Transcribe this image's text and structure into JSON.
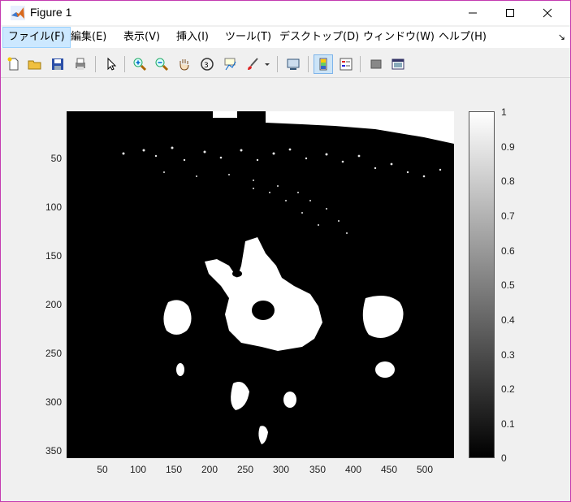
{
  "window": {
    "title": "Figure 1"
  },
  "menu": [
    {
      "label": "ファイル(F)"
    },
    {
      "label": "編集(E)"
    },
    {
      "label": "表示(V)"
    },
    {
      "label": "挿入(I)"
    },
    {
      "label": "ツール(T)"
    },
    {
      "label": "デスクトップ(D)"
    },
    {
      "label": "ウィンドウ(W)"
    },
    {
      "label": "ヘルプ(H)"
    }
  ],
  "toolbar_icons": [
    "new-figure-icon",
    "open-file-icon",
    "save-icon",
    "print-icon",
    "select-arrow-icon",
    "zoom-in-icon",
    "zoom-out-icon",
    "pan-hand-icon",
    "rotate-3d-icon",
    "data-cursor-icon",
    "brush-icon",
    "link-plot-icon",
    "colorbar-icon",
    "legend-icon",
    "hide-plot-tools-icon",
    "show-plot-tools-icon"
  ],
  "plot": {
    "y_ticks": [
      "50",
      "100",
      "150",
      "200",
      "250",
      "300",
      "350"
    ],
    "x_ticks": [
      "50",
      "100",
      "150",
      "200",
      "250",
      "300",
      "350",
      "400",
      "450",
      "500"
    ],
    "colorbar_ticks": [
      "1",
      "0.9",
      "0.8",
      "0.7",
      "0.6",
      "0.5",
      "0.4",
      "0.3",
      "0.2",
      "0.1",
      "0"
    ],
    "colormap": "gray",
    "image_description_colors": {
      "background": "#000000",
      "foreground": "#ffffff"
    }
  },
  "colors": {
    "menu_active_bg": "#cce8ff",
    "window_bg": "#f0f0f0",
    "border": "#c43bb0"
  }
}
